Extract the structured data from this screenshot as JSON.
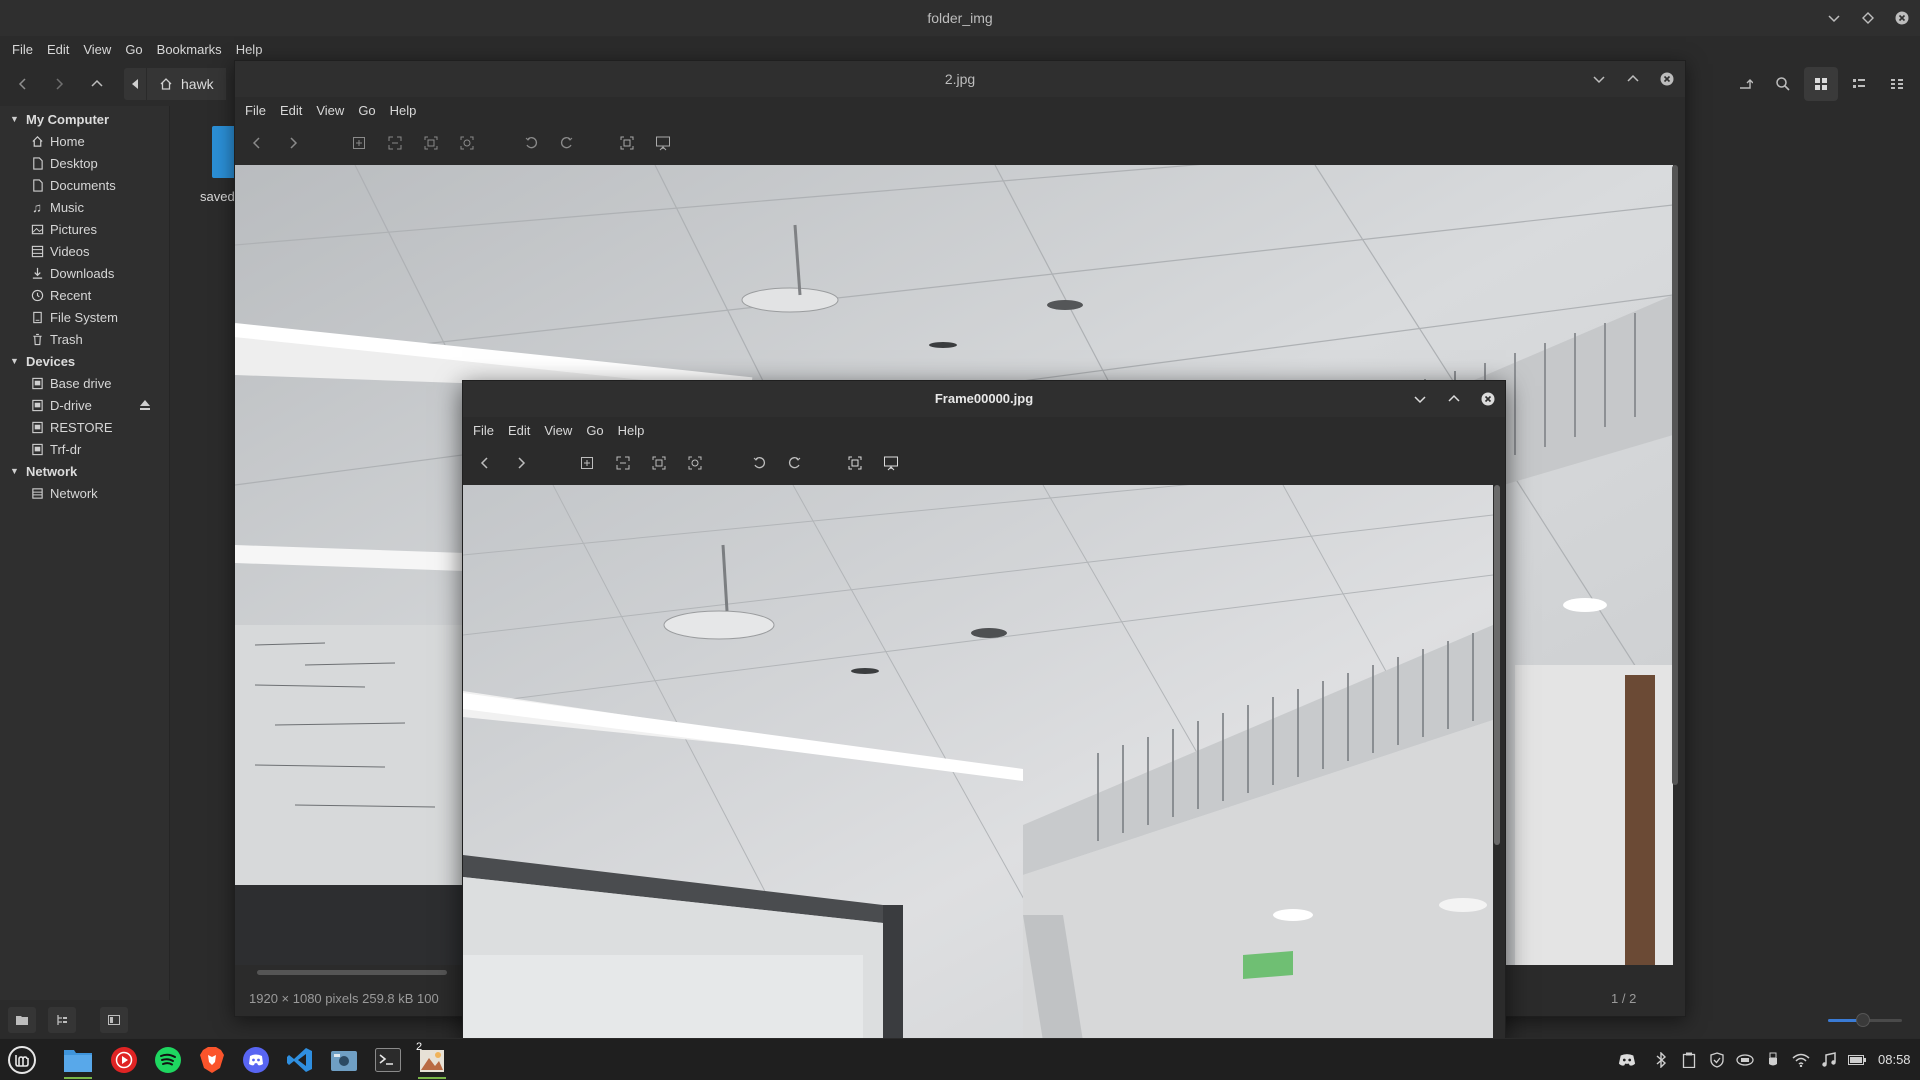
{
  "file_manager": {
    "title": "folder_img",
    "menu": [
      "File",
      "Edit",
      "View",
      "Go",
      "Bookmarks",
      "Help"
    ],
    "path": {
      "home_label": "hawk"
    },
    "sidebar": {
      "sections": [
        {
          "title": "My Computer",
          "items": [
            {
              "label": "Home",
              "icon": "home-icon"
            },
            {
              "label": "Desktop",
              "icon": "desktop-icon"
            },
            {
              "label": "Documents",
              "icon": "documents-icon"
            },
            {
              "label": "Music",
              "icon": "music-icon"
            },
            {
              "label": "Pictures",
              "icon": "pictures-icon"
            },
            {
              "label": "Videos",
              "icon": "videos-icon"
            },
            {
              "label": "Downloads",
              "icon": "downloads-icon"
            },
            {
              "label": "Recent",
              "icon": "recent-icon"
            },
            {
              "label": "File System",
              "icon": "filesystem-icon"
            },
            {
              "label": "Trash",
              "icon": "trash-icon"
            }
          ]
        },
        {
          "title": "Devices",
          "items": [
            {
              "label": "Base drive",
              "icon": "drive-icon"
            },
            {
              "label": "D-drive",
              "icon": "drive-icon"
            },
            {
              "label": "RESTORE",
              "icon": "drive-icon"
            },
            {
              "label": "Trf-dr",
              "icon": "drive-icon"
            }
          ]
        },
        {
          "title": "Network",
          "items": [
            {
              "label": "Network",
              "icon": "network-icon"
            }
          ]
        }
      ]
    },
    "content": {
      "folder_label": "saved"
    }
  },
  "viewer_back": {
    "title": "2.jpg",
    "menu": [
      "File",
      "Edit",
      "View",
      "Go",
      "Help"
    ],
    "status_left": "1920 × 1080 pixels  259.8 kB  100",
    "status_right": "1 / 2"
  },
  "viewer_front": {
    "title": "Frame00000.jpg",
    "menu": [
      "File",
      "Edit",
      "View",
      "Go",
      "Help"
    ]
  },
  "taskbar": {
    "clock": "08:58",
    "badge": "2",
    "accent": "#7ab648"
  },
  "colors": {
    "folder": "#2b8fd6",
    "selection_accent": "#3a7bd5"
  }
}
